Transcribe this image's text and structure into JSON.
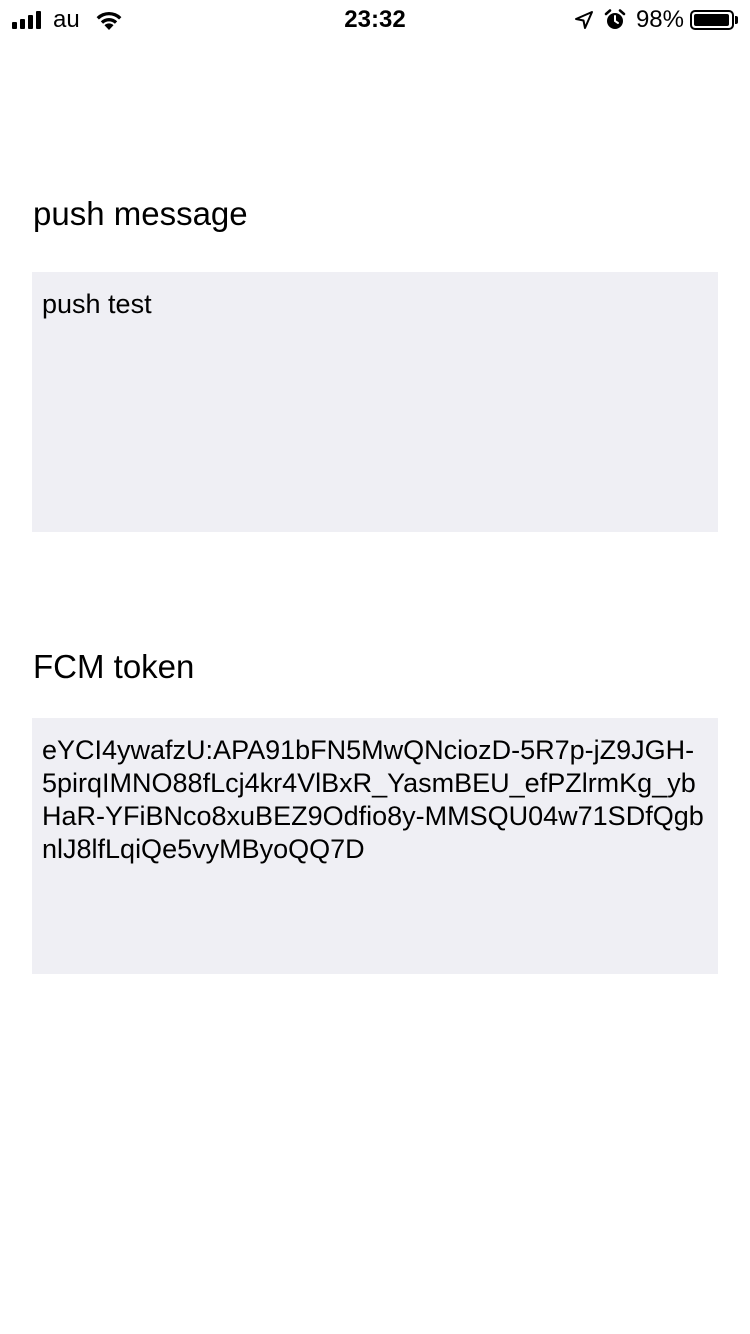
{
  "status_bar": {
    "carrier": "au",
    "time": "23:32",
    "battery_percent": "98%",
    "battery_level": 0.98,
    "signal_bars": 4,
    "icons": [
      "signal-icon",
      "wifi-icon",
      "location-arrow-icon",
      "alarm-icon",
      "battery-icon"
    ]
  },
  "push_message": {
    "label": "push message",
    "value": "push test"
  },
  "fcm_token": {
    "label": "FCM token",
    "value": "eYCI4ywafzU:APA91bFN5MwQNciozD-5R7p-jZ9JGH-5pirqIMNO88fLcj4kr4VlBxR_YasmBEU_efPZlrmKg_ybHaR-YFiBNco8xuBEZ9Odfio8y-MMSQU04w71SDfQgbnlJ8lfLqiQe5vyMByoQQ7D"
  },
  "colors": {
    "background": "#ffffff",
    "field_background": "#efeff4",
    "text": "#000000"
  }
}
